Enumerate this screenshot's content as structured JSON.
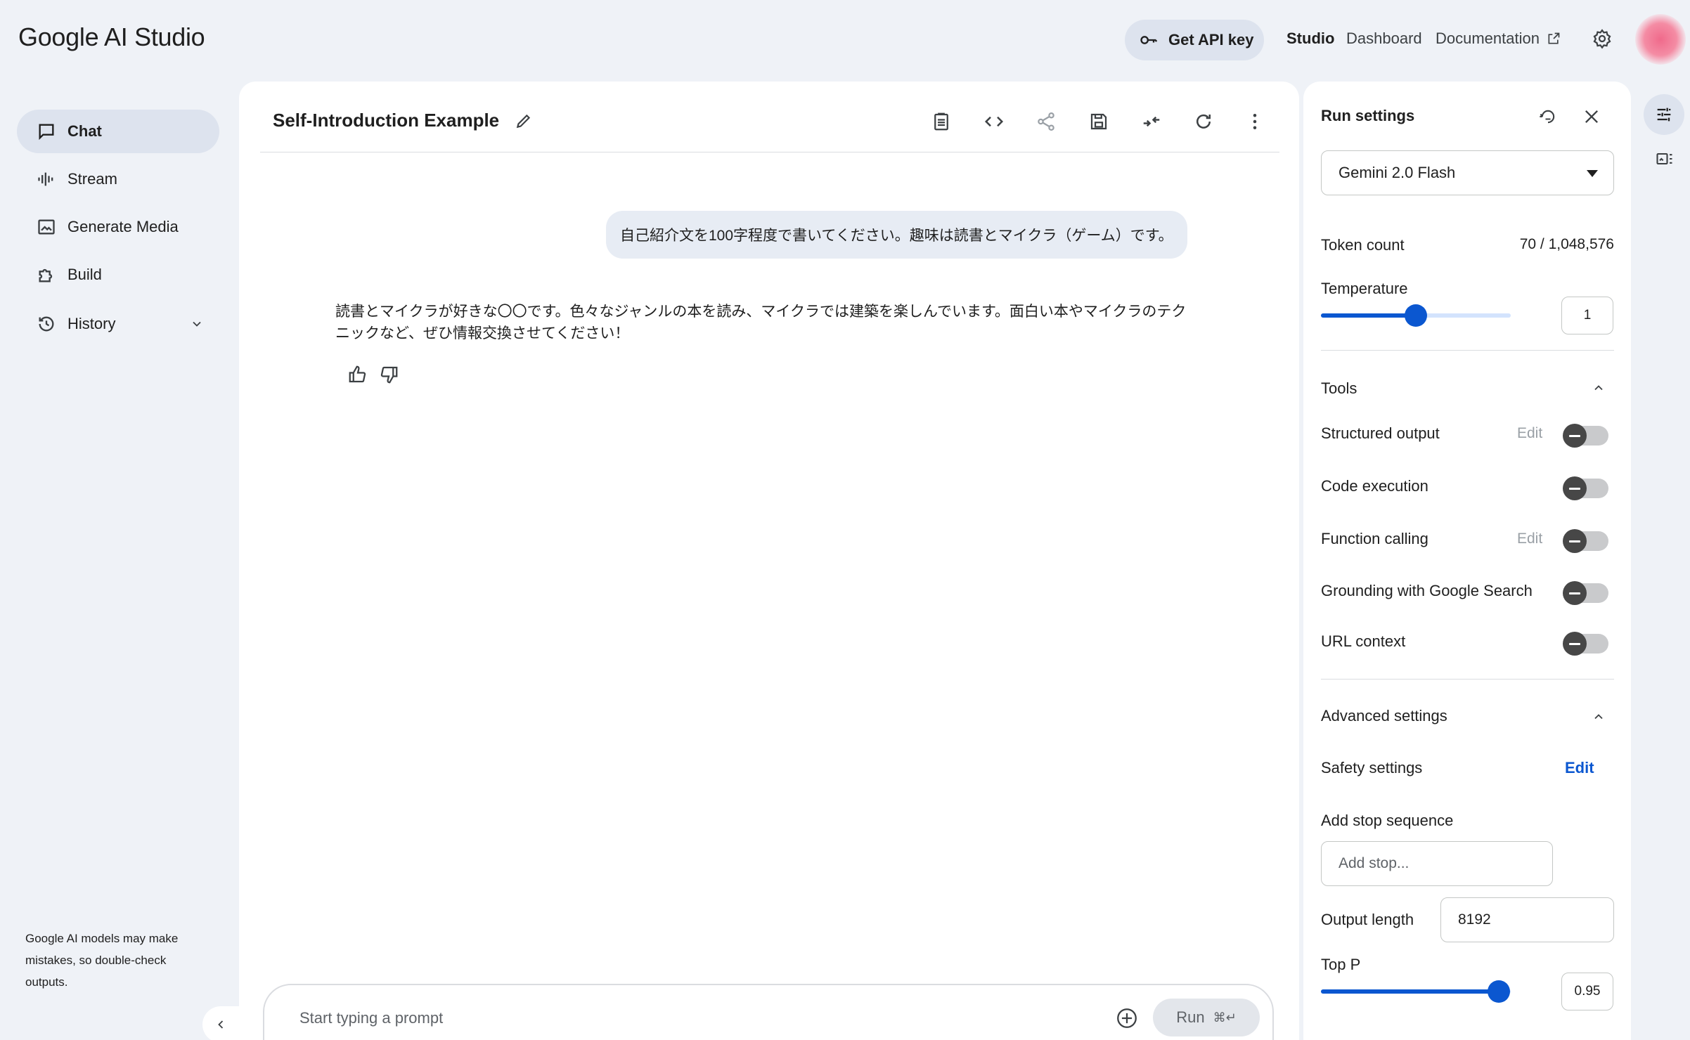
{
  "header": {
    "logo": "Google AI Studio",
    "api_key_label": "Get API key",
    "nav": {
      "studio": "Studio",
      "dashboard": "Dashboard",
      "documentation": "Documentation"
    }
  },
  "sidebar": {
    "items": [
      {
        "label": "Chat",
        "icon": "chat-icon"
      },
      {
        "label": "Stream",
        "icon": "waveform-icon"
      },
      {
        "label": "Generate Media",
        "icon": "image-icon"
      },
      {
        "label": "Build",
        "icon": "puzzle-icon"
      },
      {
        "label": "History",
        "icon": "history-icon"
      }
    ],
    "disclaimer": "Google AI models may make mistakes, so double-check outputs."
  },
  "chat": {
    "title": "Self-Introduction Example",
    "user_message": "自己紹介文を100字程度で書いてください。趣味は読書とマイクラ（ゲーム）です。",
    "model_response": "読書とマイクラが好きな〇〇です。色々なジャンルの本を読み、マイクラでは建築を楽しんでいます。面白い本やマイクラのテクニックなど、ぜひ情報交換させてください！",
    "prompt_placeholder": "Start typing a prompt",
    "run_label": "Run",
    "run_shortcut": "⌘↵"
  },
  "run_settings": {
    "title": "Run settings",
    "model": "Gemini 2.0 Flash",
    "token_count_label": "Token count",
    "token_count_value": "70 / 1,048,576",
    "temperature_label": "Temperature",
    "temperature_value": "1",
    "temperature_fraction": 0.5,
    "tools_label": "Tools",
    "tools": [
      {
        "label": "Structured output",
        "edit": "Edit",
        "enabled": false
      },
      {
        "label": "Code execution",
        "edit": "",
        "enabled": false
      },
      {
        "label": "Function calling",
        "edit": "Edit",
        "enabled": false
      },
      {
        "label": "Grounding with Google Search",
        "edit": "",
        "enabled": false
      },
      {
        "label": "URL context",
        "edit": "",
        "enabled": false
      }
    ],
    "advanced_label": "Advanced settings",
    "safety_label": "Safety settings",
    "safety_edit": "Edit",
    "stop_sequence_label": "Add stop sequence",
    "stop_sequence_placeholder": "Add stop...",
    "output_length_label": "Output length",
    "output_length_value": "8192",
    "top_p_label": "Top P",
    "top_p_value": "0.95"
  },
  "colors": {
    "accent": "#0b57d0",
    "background": "#eff2f7",
    "panel": "#ffffff"
  }
}
